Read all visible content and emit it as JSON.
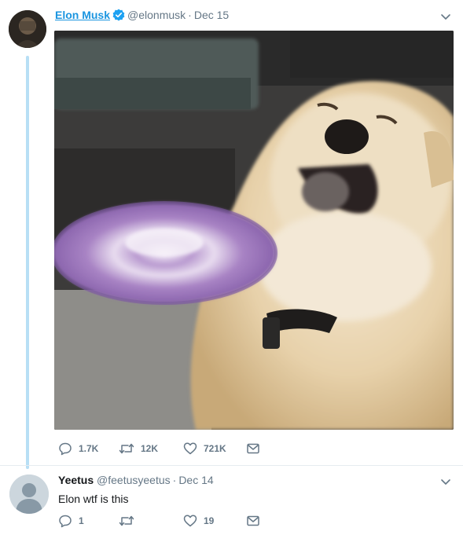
{
  "tweet1": {
    "name": "Elon Musk",
    "handle": "@elonmusk",
    "dot": "·",
    "date": "Dec 15",
    "replies": "1.7K",
    "retweets": "12K",
    "likes": "721K",
    "icons": [
      "verified-badge-icon",
      "chevron-down-icon",
      "reply-icon",
      "retweet-icon",
      "like-icon",
      "direct-message-icon"
    ]
  },
  "tweet2": {
    "name": "Yeetus",
    "handle": "@feetusyeetus",
    "dot": "·",
    "date": "Dec 14",
    "text": "Elon wtf is this",
    "replies": "1",
    "likes": "19"
  },
  "colors": {
    "link_blue": "#1b95e0",
    "thread_line": "#b8dff5",
    "muted_gray": "#657786"
  }
}
